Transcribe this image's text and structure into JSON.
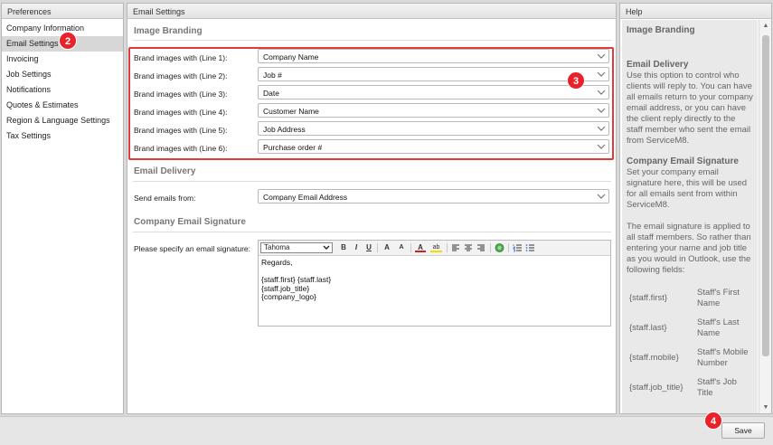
{
  "preferences": {
    "header": "Preferences",
    "items": [
      {
        "label": "Company Information"
      },
      {
        "label": "Email Settings"
      },
      {
        "label": "Invoicing"
      },
      {
        "label": "Job Settings"
      },
      {
        "label": "Notifications"
      },
      {
        "label": "Quotes & Estimates"
      },
      {
        "label": "Region & Language Settings"
      },
      {
        "label": "Tax Settings"
      }
    ]
  },
  "email_settings": {
    "header": "Email Settings",
    "image_branding": {
      "title": "Image Branding",
      "rows": [
        {
          "label": "Brand images with (Line 1):",
          "value": "Company Name"
        },
        {
          "label": "Brand images with (Line 2):",
          "value": "Job #"
        },
        {
          "label": "Brand images with (Line 3):",
          "value": "Date"
        },
        {
          "label": "Brand images with (Line 4):",
          "value": "Customer Name"
        },
        {
          "label": "Brand images with (Line 5):",
          "value": "Job Address"
        },
        {
          "label": "Brand images with (Line 6):",
          "value": "Purchase order #"
        }
      ]
    },
    "email_delivery": {
      "title": "Email Delivery",
      "label": "Send emails from:",
      "value": "Company Email Address"
    },
    "signature": {
      "title": "Company Email Signature",
      "label": "Please specify an email signature:",
      "font": "Tahoma",
      "toolbar": {
        "bold": "B",
        "italic": "I",
        "underline": "U",
        "grow": "A",
        "shrink": "A",
        "color": "A",
        "highlight": "ab"
      },
      "lines": [
        "Regards,",
        "",
        "{staff.first} {staff.last}",
        "{staff.job_title}",
        "{company_logo}"
      ]
    }
  },
  "help": {
    "header": "Help",
    "title1": "Image Branding",
    "title2": "Email Delivery",
    "text2": "Use this option to control who clients will reply to. You can have all emails return to your company email address, or you can have the client reply directly to the staff member who sent the email from ServiceM8.",
    "title3": "Company Email Signature",
    "text3": "Set your company email signature here, this will be used for all emails sent from within ServiceM8.",
    "text4": "The email signature is applied to all staff members. So rather than entering your name and job title as you would in Outlook, use the following fields:",
    "fields": [
      {
        "code": "{staff.first}",
        "desc": "Staff's First Name"
      },
      {
        "code": "{staff.last}",
        "desc": "Staff's Last Name"
      },
      {
        "code": "{staff.mobile}",
        "desc": "Staff's Mobile Number"
      },
      {
        "code": "{staff.job_title}",
        "desc": "Staff's Job Title"
      }
    ]
  },
  "footer": {
    "save_label": "Save"
  },
  "badges": {
    "b2": "2",
    "b3": "3",
    "b4": "4"
  },
  "colors": {
    "badge": "#e8212a",
    "highlight_box": "#e03a3a"
  }
}
